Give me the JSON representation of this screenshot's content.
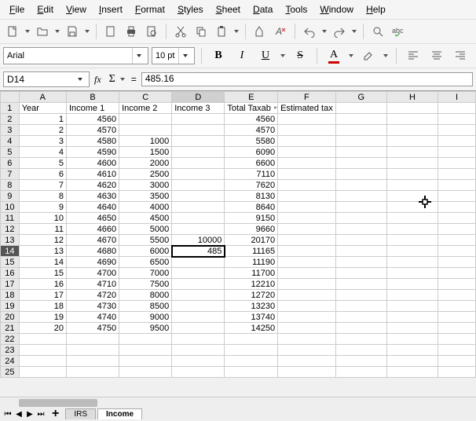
{
  "menu": [
    "File",
    "Edit",
    "View",
    "Insert",
    "Format",
    "Styles",
    "Sheet",
    "Data",
    "Tools",
    "Window",
    "Help"
  ],
  "font": {
    "name": "Arial",
    "size": "10 pt"
  },
  "cellref": "D14",
  "formula": "485.16",
  "columns": [
    "A",
    "B",
    "C",
    "D",
    "E",
    "F",
    "G",
    "H",
    "I"
  ],
  "headers": {
    "A": "Year",
    "B": "Income 1",
    "C": "Income 2",
    "D": "Income 3",
    "E": "Total Taxab",
    "F": "Estimated tax"
  },
  "chart_data": {
    "type": "table",
    "title": "Income",
    "columns": [
      "Year",
      "Income 1",
      "Income 2",
      "Income 3",
      "Total Taxable",
      "Estimated tax"
    ],
    "rows": [
      [
        1,
        4560,
        null,
        null,
        4560,
        null
      ],
      [
        2,
        4570,
        null,
        null,
        4570,
        null
      ],
      [
        3,
        4580,
        1000,
        null,
        5580,
        null
      ],
      [
        4,
        4590,
        1500,
        null,
        6090,
        null
      ],
      [
        5,
        4600,
        2000,
        null,
        6600,
        null
      ],
      [
        6,
        4610,
        2500,
        null,
        7110,
        null
      ],
      [
        7,
        4620,
        3000,
        null,
        7620,
        null
      ],
      [
        8,
        4630,
        3500,
        null,
        8130,
        null
      ],
      [
        9,
        4640,
        4000,
        null,
        8640,
        null
      ],
      [
        10,
        4650,
        4500,
        null,
        9150,
        null
      ],
      [
        11,
        4660,
        5000,
        null,
        9660,
        null
      ],
      [
        12,
        4670,
        5500,
        10000,
        20170,
        null
      ],
      [
        13,
        4680,
        6000,
        485,
        11165,
        null
      ],
      [
        14,
        4690,
        6500,
        null,
        11190,
        null
      ],
      [
        15,
        4700,
        7000,
        null,
        11700,
        null
      ],
      [
        16,
        4710,
        7500,
        null,
        12210,
        null
      ],
      [
        17,
        4720,
        8000,
        null,
        12720,
        null
      ],
      [
        18,
        4730,
        8500,
        null,
        13230,
        null
      ],
      [
        19,
        4740,
        9000,
        null,
        13740,
        null
      ],
      [
        20,
        4750,
        9500,
        null,
        14250,
        null
      ]
    ]
  },
  "tabs": [
    "IRS",
    "Income"
  ],
  "active_tab": 1,
  "active_cell": {
    "row": 14,
    "col": "D"
  },
  "total_rows": 25
}
